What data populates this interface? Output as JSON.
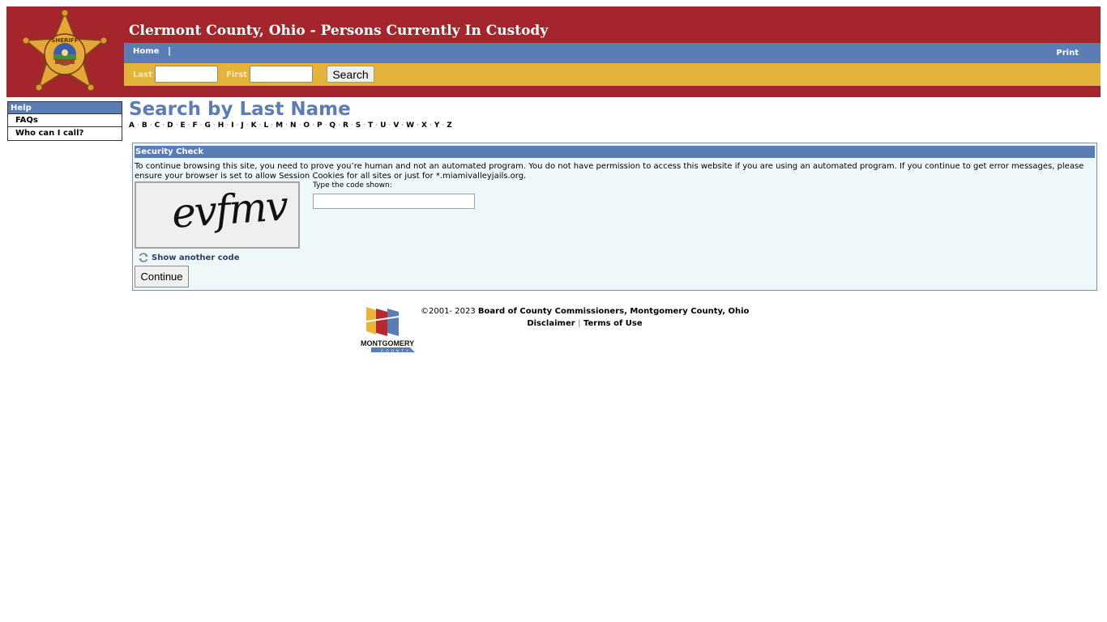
{
  "header": {
    "title": "Clermont County, Ohio - Persons Currently In Custody",
    "logo_icon": "sheriff-star-badge-icon"
  },
  "nav": {
    "home_label": "Home",
    "separator": "|",
    "print_label": "Print"
  },
  "search_bar": {
    "last_label": "Last",
    "last_value": "",
    "first_label": "First",
    "first_value": "",
    "search_button": "Search"
  },
  "sidebar": {
    "heading": "Help",
    "items": [
      {
        "label": "FAQs"
      },
      {
        "label": "Who can I call?"
      }
    ]
  },
  "main": {
    "title": "Search by Last Name",
    "letters": [
      "A",
      "B",
      "C",
      "D",
      "E",
      "F",
      "G",
      "H",
      "I",
      "J",
      "K",
      "L",
      "M",
      "N",
      "O",
      "P",
      "Q",
      "R",
      "S",
      "T",
      "U",
      "V",
      "W",
      "X",
      "Y",
      "Z"
    ]
  },
  "security_check": {
    "heading": "Security Check",
    "message": "To continue browsing this site, you need to prove you’re human and not an automated program. You do not have permission to access this website if you are using an automated program. If you continue to get error messages, please ensure your browser is set to allow Session Cookies for all sites or just for *.miamivalleyjails.org.",
    "captcha_text": "evfmv",
    "code_label": "Type the code shown:",
    "code_value": "",
    "refresh_label": "Show another code",
    "refresh_icon": "refresh-icon",
    "continue_button": "Continue"
  },
  "footer": {
    "copyright_prefix": "©2001- 2023 ",
    "copyright_owner": "Board of County Commissioners, Montgomery County, Ohio",
    "disclaimer_label": "Disclaimer",
    "separator": "|",
    "terms_label": "Terms of Use",
    "logo_text": "MONTGOMERY",
    "logo_subtext": "COUNTY"
  },
  "colors": {
    "header_red": "#a4262c",
    "nav_blue": "#5a7db5",
    "search_gold": "#e3b33a",
    "panel_bg": "#eff8f8"
  }
}
